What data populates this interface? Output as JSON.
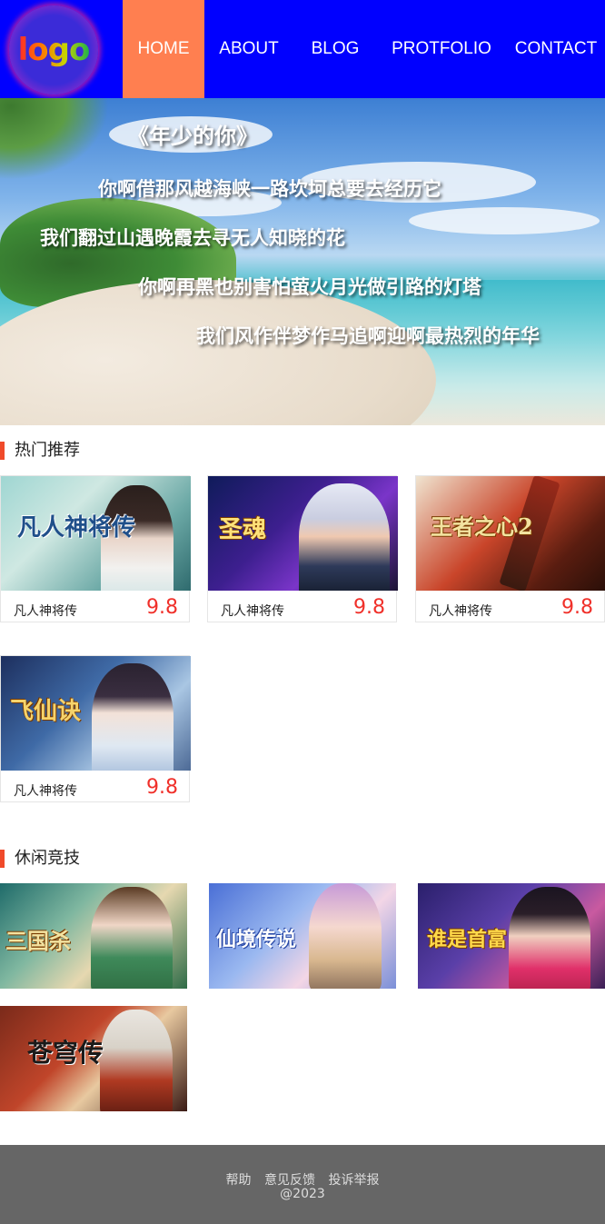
{
  "header": {
    "logo_text": "logo",
    "nav": [
      {
        "label": "HOME",
        "active": true
      },
      {
        "label": "ABOUT",
        "active": false
      },
      {
        "label": "BLOG",
        "active": false
      },
      {
        "label": "PROTFOLIO",
        "active": false
      },
      {
        "label": "CONTACT",
        "active": false
      }
    ],
    "colors": {
      "bar": "#0000ff",
      "active": "#ff7f50"
    }
  },
  "banner": {
    "lines": [
      "《年少的你》",
      "你啊借那风越海峡一路坎坷总要去经历它",
      "我们翻过山遇晚霞去寻无人知晓的花",
      "你啊再黑也别害怕萤火月光做引路的灯塔",
      "我们风作伴梦作马追啊迎啊最热烈的年华"
    ]
  },
  "hot": {
    "title": "热门推荐",
    "cards": [
      {
        "game": "凡人神将传",
        "name": "凡人神将传",
        "score": "9.8"
      },
      {
        "game": "圣魂",
        "name": "凡人神将传",
        "score": "9.8"
      },
      {
        "game": "王者之心2",
        "name": "凡人神将传",
        "score": "9.8"
      },
      {
        "game": "飞仙诀",
        "name": "凡人神将传",
        "score": "9.8"
      }
    ]
  },
  "casual": {
    "title": "休闲竞技",
    "thumbs": [
      {
        "game": "三国杀"
      },
      {
        "game": "仙境传说"
      },
      {
        "game": "谁是首富"
      },
      {
        "game": "苍穹传"
      }
    ]
  },
  "footer": {
    "links": [
      "帮助",
      "意见反馈",
      "投诉举报"
    ],
    "copyright": "@2023"
  },
  "accent_color": "#f04a2a"
}
